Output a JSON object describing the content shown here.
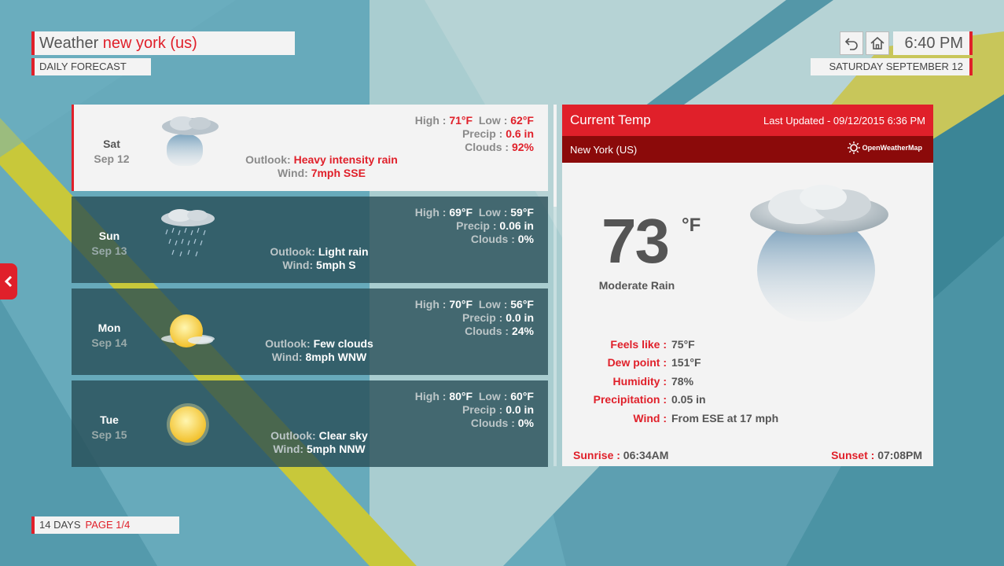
{
  "header": {
    "title_prefix": "Weather",
    "city": "new york (us)",
    "subtitle": "DAILY FORECAST",
    "time": "6:40 PM",
    "date": "SATURDAY SEPTEMBER 12"
  },
  "icons": {
    "back": "back-arrow-icon",
    "home": "home-icon",
    "left_tab": "chevron-left-icon"
  },
  "colors": {
    "accent": "#e0202a",
    "accent_dark": "#8b0a0a",
    "panel": "#f3f3f3"
  },
  "labels": {
    "high": "High :",
    "low": "Low :",
    "precip": "Precip :",
    "clouds": "Clouds :",
    "outlook": "Outlook:",
    "wind": "Wind:"
  },
  "days": [
    {
      "name": "Sat",
      "date": "Sep 12",
      "high": "71°F",
      "low": "62°F",
      "precip": "0.6 in",
      "clouds": "92%",
      "outlook": "Heavy intensity rain",
      "wind": "7mph SSE",
      "icon": "heavy-rain-icon"
    },
    {
      "name": "Sun",
      "date": "Sep 13",
      "high": "69°F",
      "low": "59°F",
      "precip": "0.06 in",
      "clouds": "0%",
      "outlook": "Light rain",
      "wind": "5mph S",
      "icon": "light-rain-icon"
    },
    {
      "name": "Mon",
      "date": "Sep 14",
      "high": "70°F",
      "low": "56°F",
      "precip": "0.0 in",
      "clouds": "24%",
      "outlook": "Few clouds",
      "wind": "8mph WNW",
      "icon": "few-clouds-icon"
    },
    {
      "name": "Tue",
      "date": "Sep 15",
      "high": "80°F",
      "low": "60°F",
      "precip": "0.0 in",
      "clouds": "0%",
      "outlook": "Clear sky",
      "wind": "5mph NNW",
      "icon": "sun-icon"
    }
  ],
  "current": {
    "title": "Current Temp",
    "updated": "Last Updated - 09/12/2015 6:36 PM",
    "city": "New York (US)",
    "provider": "OpenWeatherMap",
    "temp": "73",
    "unit": "°F",
    "condition": "Moderate Rain",
    "icon": "moderate-rain-icon",
    "details": [
      {
        "label": "Feels like :",
        "value": "75°F"
      },
      {
        "label": "Dew point :",
        "value": "151°F"
      },
      {
        "label": "Humidity :",
        "value": "78%"
      },
      {
        "label": "Precipitation :",
        "value": "0.05 in"
      },
      {
        "label": "Wind :",
        "value": "From ESE at 17 mph"
      }
    ],
    "sunrise_label": "Sunrise :",
    "sunrise": "06:34AM",
    "sunset_label": "Sunset :",
    "sunset": "07:08PM"
  },
  "footer": {
    "range": "14 DAYS",
    "page": "PAGE 1/4"
  }
}
